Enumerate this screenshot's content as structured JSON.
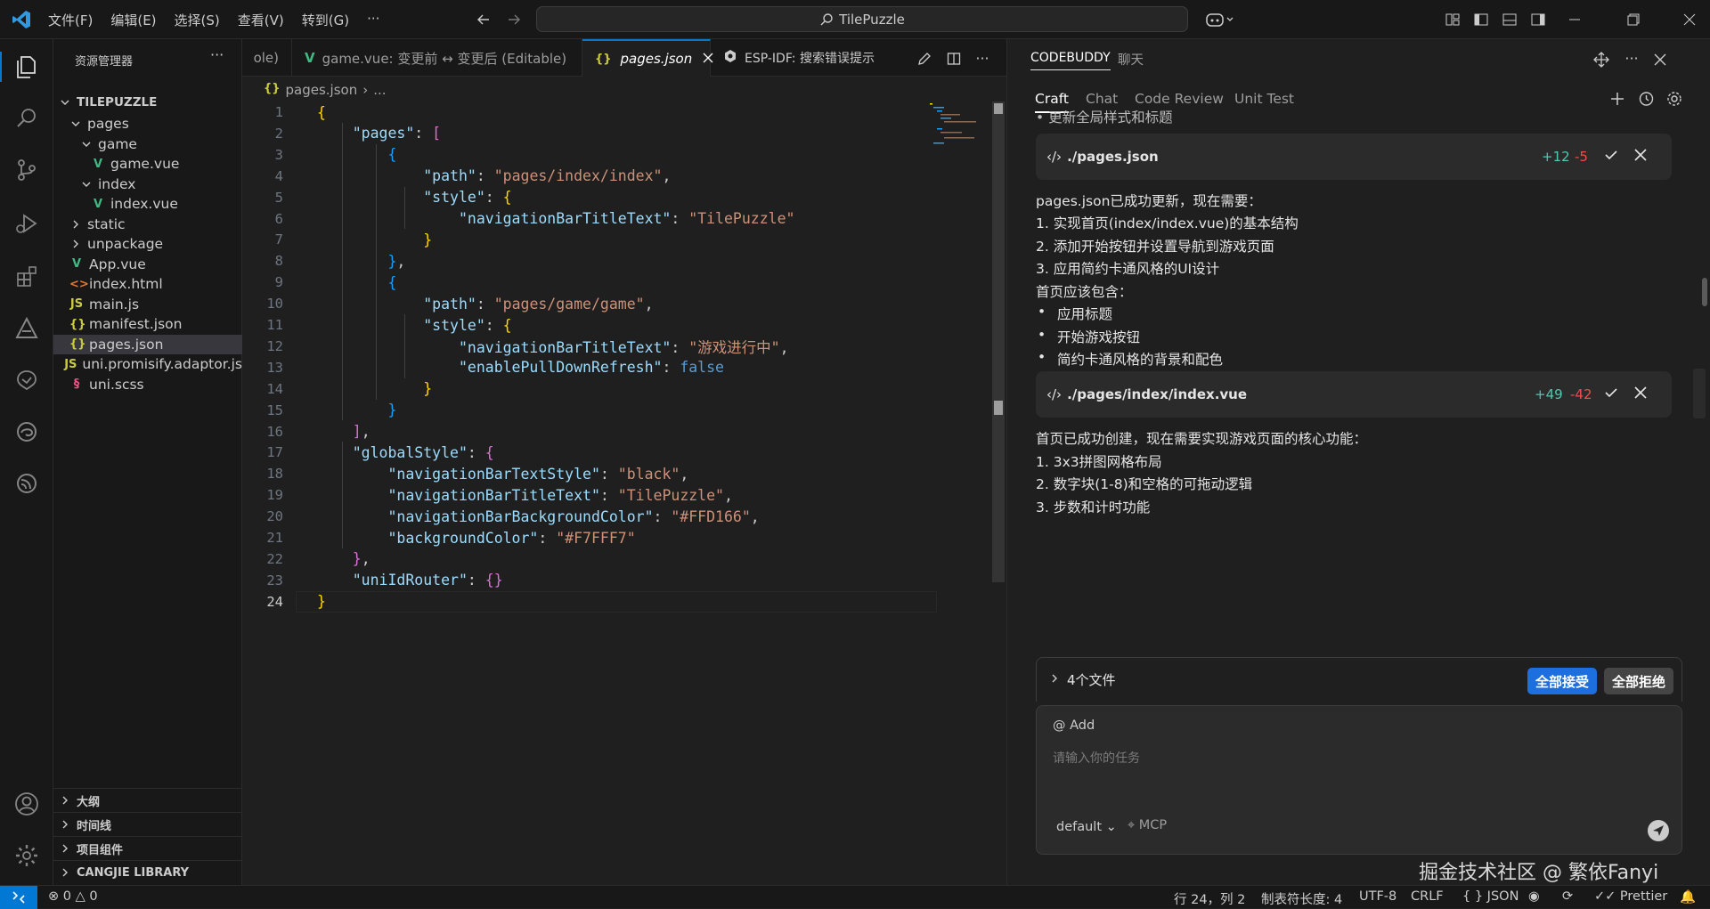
{
  "menu": [
    "文件(F)",
    "编辑(E)",
    "选择(S)",
    "查看(V)",
    "转到(G)",
    "···"
  ],
  "search": {
    "text": "TilePuzzle"
  },
  "explorer": {
    "title": "资源管理器",
    "root": "TILEPUZZLE",
    "items": [
      {
        "label": "pages",
        "indent": 1,
        "type": "folder-open"
      },
      {
        "label": "game",
        "indent": 2,
        "type": "folder-open"
      },
      {
        "label": "game.vue",
        "indent": 3,
        "type": "vue"
      },
      {
        "label": "index",
        "indent": 2,
        "type": "folder-open"
      },
      {
        "label": "index.vue",
        "indent": 3,
        "type": "vue"
      },
      {
        "label": "static",
        "indent": 1,
        "type": "folder"
      },
      {
        "label": "unpackage",
        "indent": 1,
        "type": "folder"
      },
      {
        "label": "App.vue",
        "indent": 1,
        "type": "vue"
      },
      {
        "label": "index.html",
        "indent": 1,
        "type": "html"
      },
      {
        "label": "main.js",
        "indent": 1,
        "type": "js"
      },
      {
        "label": "manifest.json",
        "indent": 1,
        "type": "json"
      },
      {
        "label": "pages.json",
        "indent": 1,
        "type": "json",
        "selected": true
      },
      {
        "label": "uni.promisify.adaptor.js",
        "indent": 1,
        "type": "js"
      },
      {
        "label": "uni.scss",
        "indent": 1,
        "type": "scss"
      }
    ],
    "sections": [
      "大纲",
      "时间线",
      "项目组件",
      "CANGJIE LIBRARY"
    ]
  },
  "tabs": [
    {
      "label": "ole)"
    },
    {
      "label": "game.vue: 变更前 ↔ 变更后 (Editable)"
    },
    {
      "label": "pages.json",
      "active": true
    },
    {
      "label": "ESP-IDF: 搜索错误提示"
    }
  ],
  "breadcrumb": [
    "pages.json",
    "..."
  ],
  "code": [
    [
      [
        "b1",
        "{"
      ]
    ],
    [
      [
        "p",
        "    "
      ],
      [
        "k",
        "\"pages\""
      ],
      [
        "p",
        ": "
      ],
      [
        "b2",
        "["
      ]
    ],
    [
      [
        "p",
        "        "
      ],
      [
        "b3",
        "{"
      ]
    ],
    [
      [
        "p",
        "            "
      ],
      [
        "k",
        "\"path\""
      ],
      [
        "p",
        ": "
      ],
      [
        "s",
        "\"pages/index/index\""
      ],
      [
        "p",
        ","
      ]
    ],
    [
      [
        "p",
        "            "
      ],
      [
        "k",
        "\"style\""
      ],
      [
        "p",
        ": "
      ],
      [
        "b1",
        "{"
      ]
    ],
    [
      [
        "p",
        "                "
      ],
      [
        "k",
        "\"navigationBarTitleText\""
      ],
      [
        "p",
        ": "
      ],
      [
        "s",
        "\"TilePuzzle\""
      ]
    ],
    [
      [
        "p",
        "            "
      ],
      [
        "b1",
        "}"
      ]
    ],
    [
      [
        "p",
        "        "
      ],
      [
        "b3",
        "}"
      ],
      [
        "p",
        ","
      ]
    ],
    [
      [
        "p",
        "        "
      ],
      [
        "b3",
        "{"
      ]
    ],
    [
      [
        "p",
        "            "
      ],
      [
        "k",
        "\"path\""
      ],
      [
        "p",
        ": "
      ],
      [
        "s",
        "\"pages/game/game\""
      ],
      [
        "p",
        ","
      ]
    ],
    [
      [
        "p",
        "            "
      ],
      [
        "k",
        "\"style\""
      ],
      [
        "p",
        ": "
      ],
      [
        "b1",
        "{"
      ]
    ],
    [
      [
        "p",
        "                "
      ],
      [
        "k",
        "\"navigationBarTitleText\""
      ],
      [
        "p",
        ": "
      ],
      [
        "s",
        "\"游戏进行中\""
      ],
      [
        "p",
        ","
      ]
    ],
    [
      [
        "p",
        "                "
      ],
      [
        "k",
        "\"enablePullDownRefresh\""
      ],
      [
        "p",
        ": "
      ],
      [
        "kw",
        "false"
      ]
    ],
    [
      [
        "p",
        "            "
      ],
      [
        "b1",
        "}"
      ]
    ],
    [
      [
        "p",
        "        "
      ],
      [
        "b3",
        "}"
      ]
    ],
    [
      [
        "p",
        "    "
      ],
      [
        "b2",
        "]"
      ],
      [
        "p",
        ","
      ]
    ],
    [
      [
        "p",
        "    "
      ],
      [
        "k",
        "\"globalStyle\""
      ],
      [
        "p",
        ": "
      ],
      [
        "b2",
        "{"
      ]
    ],
    [
      [
        "p",
        "        "
      ],
      [
        "k",
        "\"navigationBarTextStyle\""
      ],
      [
        "p",
        ": "
      ],
      [
        "s",
        "\"black\""
      ],
      [
        "p",
        ","
      ]
    ],
    [
      [
        "p",
        "        "
      ],
      [
        "k",
        "\"navigationBarTitleText\""
      ],
      [
        "p",
        ": "
      ],
      [
        "s",
        "\"TilePuzzle\""
      ],
      [
        "p",
        ","
      ]
    ],
    [
      [
        "p",
        "        "
      ],
      [
        "k",
        "\"navigationBarBackgroundColor\""
      ],
      [
        "p",
        ": "
      ],
      [
        "s",
        "\"#FFD166\""
      ],
      [
        "p",
        ","
      ]
    ],
    [
      [
        "p",
        "        "
      ],
      [
        "k",
        "\"backgroundColor\""
      ],
      [
        "p",
        ": "
      ],
      [
        "s",
        "\"#F7FFF7\""
      ]
    ],
    [
      [
        "p",
        "    "
      ],
      [
        "b2",
        "}"
      ],
      [
        "p",
        ","
      ]
    ],
    [
      [
        "p",
        "    "
      ],
      [
        "k",
        "\"uniIdRouter\""
      ],
      [
        "p",
        ": "
      ],
      [
        "b2",
        "{}"
      ]
    ],
    [
      [
        "b1",
        "}"
      ]
    ]
  ],
  "panel": {
    "title": "CODEBUDDY",
    "title2": "聊天",
    "subtabs": [
      "Craft",
      "Chat",
      "Code Review",
      "Unit Test"
    ],
    "cut_line": "• 更新全局样式和标题",
    "card1": {
      "file": "./pages.json",
      "add": "+12",
      "del": "-5"
    },
    "msg1": [
      "pages.json已成功更新，现在需要：",
      "1. 实现首页(index/index.vue)的基本结构",
      "2. 添加开始按钮并设置导航到游戏页面",
      "3. 应用简约卡通风格的UI设计",
      "首页应该包含："
    ],
    "bullets": [
      "应用标题",
      "开始游戏按钮",
      "简约卡通风格的背景和配色"
    ],
    "card2": {
      "file": "./pages/index/index.vue",
      "add": "+49",
      "del": "-42"
    },
    "msg2": [
      "首页已成功创建，现在需要实现游戏页面的核心功能：",
      "1. 3x3拼图网格布局",
      "2. 数字块(1-8)和空格的可拖动逻辑",
      "3. 步数和计时功能"
    ],
    "files_summary": "4个文件",
    "accept_all": "全部接受",
    "reject_all": "全部拒绝",
    "input_add": "@ Add",
    "input_placeholder": "请输入你的任务",
    "model": "default",
    "mcp": "MCP",
    "watermark": "掘金技术社区 @ 繁依Fanyi"
  },
  "status": {
    "errors": "0",
    "warnings": "0",
    "position": "行 24，列 2",
    "tab_size": "制表符长度: 4",
    "encoding": "UTF-8",
    "eol": "CRLF",
    "lang": "JSON",
    "prettier": "Prettier"
  },
  "colors": {
    "accent": "#0078d4",
    "add": "#4ec9b0",
    "del": "#f14c4c",
    "vue": "#42b883",
    "json": "#cbcb41",
    "html": "#e37933",
    "js": "#cbcb41",
    "scss": "#f55385"
  }
}
